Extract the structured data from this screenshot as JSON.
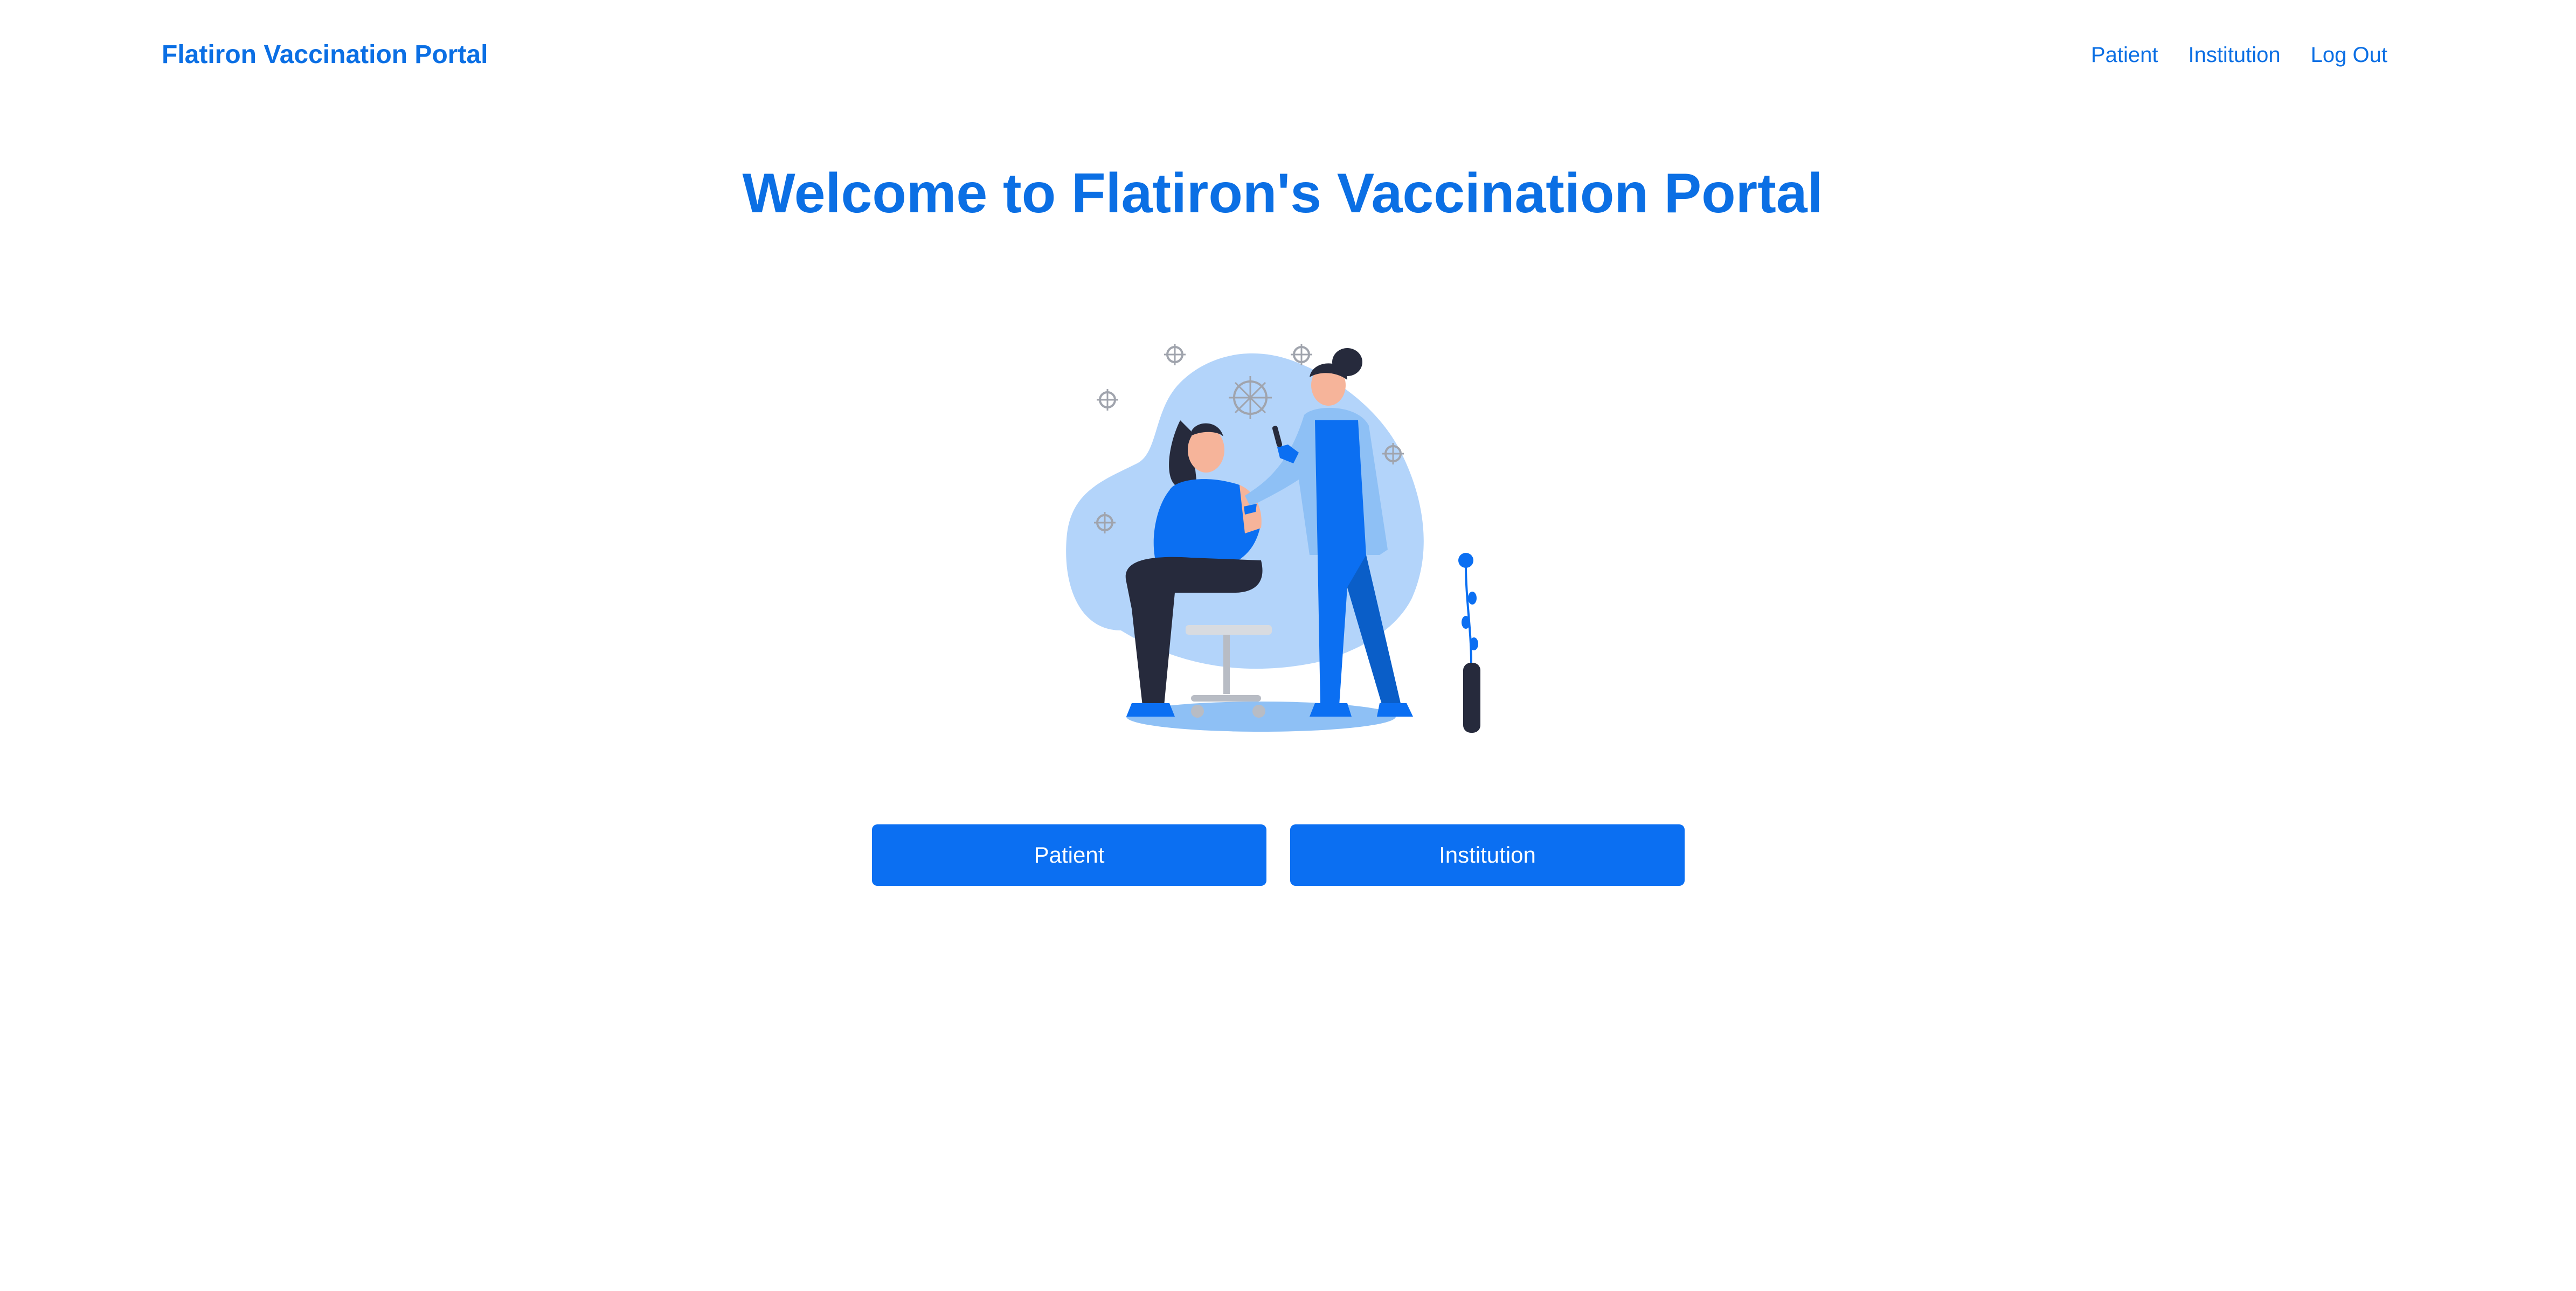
{
  "navbar": {
    "brand": "Flatiron Vaccination Portal",
    "links": [
      {
        "label": "Patient"
      },
      {
        "label": "Institution"
      },
      {
        "label": "Log Out"
      }
    ]
  },
  "hero": {
    "title": "Welcome to Flatiron's Vaccination Portal",
    "illustration_icon": "vaccination-illustration"
  },
  "actions": {
    "patient_label": "Patient",
    "institution_label": "Institution"
  },
  "colors": {
    "brand_blue": "#0b6fe4",
    "button_blue": "#0b6ff2",
    "blob_light_blue": "#b3d4fa",
    "shirt_blue": "#0b6ff2",
    "coat_blue": "#8ec0f5",
    "dark_navy": "#262a3c"
  }
}
